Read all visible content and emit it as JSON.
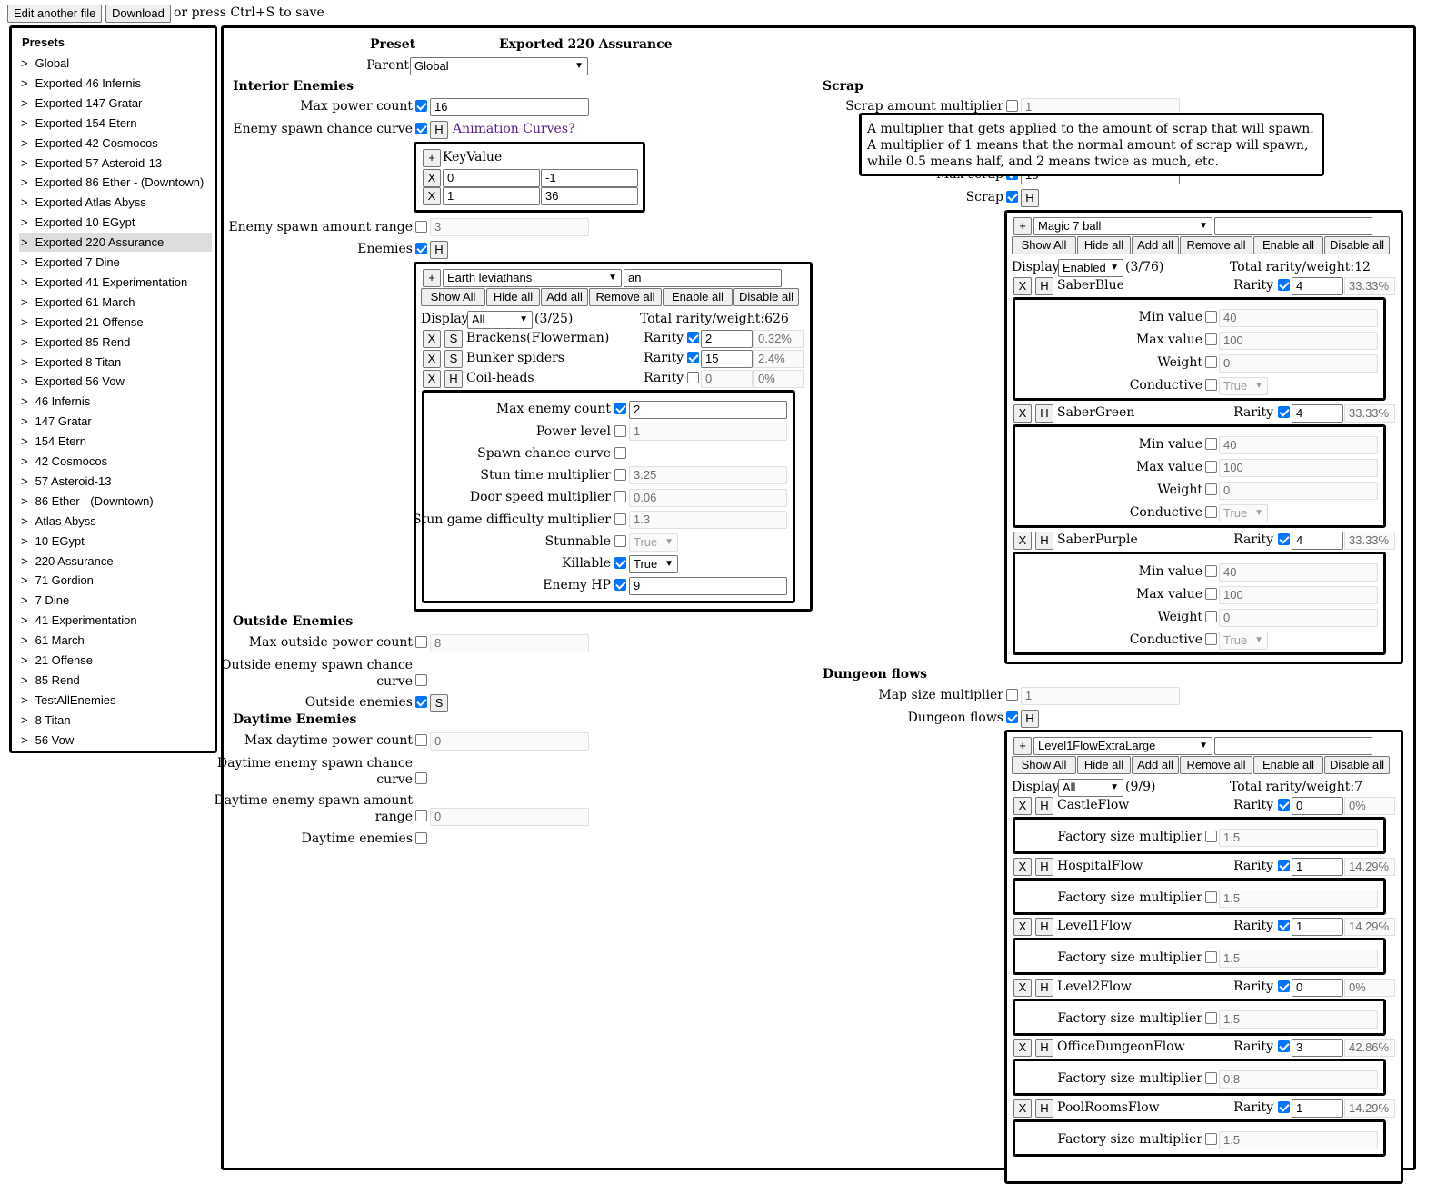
{
  "topbar": {
    "edit_label": "Edit another file",
    "download_label": "Download",
    "save_hint": "or press Ctrl+S to save"
  },
  "sidebar": {
    "title": "Presets",
    "chevron": ">",
    "items": [
      "Global",
      "Exported 46 Infernis",
      "Exported 147 Gratar",
      "Exported 154 Etern",
      "Exported 42 Cosmocos",
      "Exported 57 Asteroid-13",
      "Exported 86 Ether - (Downtown)",
      "Exported Atlas Abyss",
      "Exported 10 EGypt",
      "Exported 220 Assurance",
      "Exported 7 Dine",
      "Exported 41 Experimentation",
      "Exported 61 March",
      "Exported 21 Offense",
      "Exported 85 Rend",
      "Exported 8 Titan",
      "Exported 56 Vow",
      "46 Infernis",
      "147 Gratar",
      "154 Etern",
      "42 Cosmocos",
      "57 Asteroid-13",
      "86 Ether - (Downtown)",
      "Atlas Abyss",
      "10 EGypt",
      "220 Assurance",
      "71 Gordion",
      "7 Dine",
      "41 Experimentation",
      "61 March",
      "21 Offense",
      "85 Rend",
      "TestAllEnemies",
      "8 Titan",
      "56 Vow"
    ],
    "selected_index": 9
  },
  "preset": {
    "label": "Preset",
    "name": "Exported 220 Assurance",
    "parent_label": "Parent",
    "parent_value": "Global"
  },
  "interior": {
    "heading": "Interior Enemies",
    "max_power_label": "Max power count",
    "max_power_value": "16",
    "spawn_curve_label": "Enemy spawn chance curve",
    "h": "H",
    "curve_link": "Animation Curves?",
    "curve_table": {
      "plus": "+",
      "header": "KeyValue",
      "x": "X",
      "rows": [
        [
          "0",
          "-1"
        ],
        [
          "1",
          "36"
        ]
      ]
    },
    "spawn_amount_label": "Enemy spawn amount range",
    "spawn_amount_value": "3",
    "enemies_label": "Enemies",
    "enemies_panel": {
      "plus": "+",
      "select_value": "Earth leviathans",
      "search_value": "an",
      "buttons": [
        "Show All",
        "Hide all",
        "Add all",
        "Remove all",
        "Enable all",
        "Disable all"
      ],
      "display_label": "Display",
      "display_value": "All",
      "count": "(3/25)",
      "total": "Total rarity/weight:626",
      "rarity_label": "Rarity",
      "rows": [
        {
          "x": "X",
          "s": "S",
          "name": "Brackens(Flowerman)",
          "rarity": "2",
          "pct": "0.32%"
        },
        {
          "x": "X",
          "s": "S",
          "name": "Bunker spiders",
          "rarity": "15",
          "pct": "2.4%"
        },
        {
          "x": "X",
          "s": "H",
          "name": "Coil-heads",
          "rarity": "0",
          "pct": "0%"
        }
      ],
      "details": {
        "max_enemy_label": "Max enemy count",
        "max_enemy_value": "2",
        "power_label": "Power level",
        "power_value": "1",
        "curve_label": "Spawn chance curve",
        "stun_time_label": "Stun time multiplier",
        "stun_time_value": "3.25",
        "door_label": "Door speed multiplier",
        "door_value": "0.06",
        "stun_diff_label": "Stun game difficulty multiplier",
        "stun_diff_value": "1.3",
        "stunnable_label": "Stunnable",
        "stunnable_value": "True",
        "killable_label": "Killable",
        "killable_value": "True",
        "hp_label": "Enemy HP",
        "hp_value": "9"
      }
    }
  },
  "outside": {
    "heading": "Outside Enemies",
    "max_power_label": "Max outside power count",
    "max_power_value": "8",
    "curve_label_1": "Outside enemy spawn chance",
    "curve_label_2": "curve",
    "enemies_label": "Outside enemies",
    "s": "S"
  },
  "daytime": {
    "heading": "Daytime Enemies",
    "max_power_label": "Max daytime power count",
    "max_power_value": "0",
    "curve_label_1": "Daytime enemy spawn chance",
    "curve_label_2": "curve",
    "amount_label_1": "Daytime enemy spawn amount",
    "amount_label_2": "range",
    "amount_value": "0",
    "enemies_label": "Daytime enemies"
  },
  "scrap": {
    "heading": "Scrap",
    "multiplier_label": "Scrap amount multiplier",
    "multiplier_value": "1",
    "tooltip": "A multiplier that gets applied to the amount of scrap that will spawn. A multiplier of 1 means that the normal amount of scrap will spawn, while 0.5 means half, and 2 means twice as much, etc.",
    "max_scrap_label": "Max scrap",
    "max_scrap_value": "15",
    "scrap_label": "Scrap",
    "h": "H",
    "panel": {
      "plus": "+",
      "select_value": "Magic 7 ball",
      "search_value": "",
      "buttons": [
        "Show All",
        "Hide all",
        "Add all",
        "Remove all",
        "Enable all",
        "Disable all"
      ],
      "display_label": "Display",
      "display_value": "Enabled",
      "count": "(3/76)",
      "total": "Total rarity/weight:12",
      "rarity_label": "Rarity",
      "min_label": "Min value",
      "max_label": "Max value",
      "weight_label": "Weight",
      "conductive_label": "Conductive",
      "items": [
        {
          "x": "X",
          "h": "H",
          "name": "SaberBlue",
          "rarity": "4",
          "pct": "33.33%",
          "min": "40",
          "max": "100",
          "weight": "0",
          "conductive": "True"
        },
        {
          "x": "X",
          "h": "H",
          "name": "SaberGreen",
          "rarity": "4",
          "pct": "33.33%",
          "min": "40",
          "max": "100",
          "weight": "0",
          "conductive": "True"
        },
        {
          "x": "X",
          "h": "H",
          "name": "SaberPurple",
          "rarity": "4",
          "pct": "33.33%",
          "min": "40",
          "max": "100",
          "weight": "0",
          "conductive": "True"
        }
      ]
    }
  },
  "dungeon": {
    "heading": "Dungeon flows",
    "map_size_label": "Map size multiplier",
    "map_size_value": "1",
    "flows_label": "Dungeon flows",
    "h": "H",
    "panel": {
      "plus": "+",
      "select_value": "Level1FlowExtraLarge",
      "search_value": "",
      "buttons": [
        "Show All",
        "Hide all",
        "Add all",
        "Remove all",
        "Enable all",
        "Disable all"
      ],
      "display_label": "Display",
      "display_value": "All",
      "count": "(9/9)",
      "total": "Total rarity/weight:7",
      "rarity_label": "Rarity",
      "factory_label": "Factory size multiplier",
      "items": [
        {
          "x": "X",
          "h": "H",
          "name": "CastleFlow",
          "rarity": "0",
          "pct": "0%",
          "factory": "1.5"
        },
        {
          "x": "X",
          "h": "H",
          "name": "HospitalFlow",
          "rarity": "1",
          "pct": "14.29%",
          "factory": "1.5"
        },
        {
          "x": "X",
          "h": "H",
          "name": "Level1Flow",
          "rarity": "1",
          "pct": "14.29%",
          "factory": "1.5"
        },
        {
          "x": "X",
          "h": "H",
          "name": "Level2Flow",
          "rarity": "0",
          "pct": "0%",
          "factory": "1.5"
        },
        {
          "x": "X",
          "h": "H",
          "name": "OfficeDungeonFlow",
          "rarity": "3",
          "pct": "42.86%",
          "factory": "0.8"
        },
        {
          "x": "X",
          "h": "H",
          "name": "PoolRoomsFlow",
          "rarity": "1",
          "pct": "14.29%",
          "factory": "1.5"
        }
      ]
    }
  }
}
